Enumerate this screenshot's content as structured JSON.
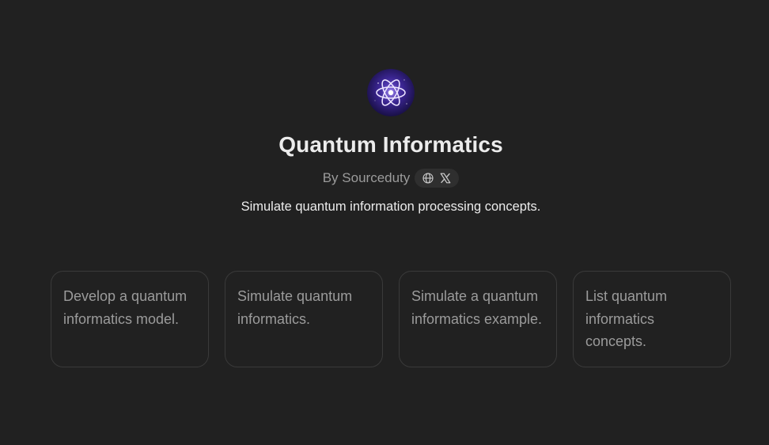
{
  "gpt": {
    "avatar_icon": "atom-icon",
    "name": "Quantum Informatics",
    "byline": "By Sourceduty",
    "links": [
      {
        "icon": "globe-icon"
      },
      {
        "icon": "x-logo-icon"
      }
    ],
    "description": "Simulate quantum information processing concepts."
  },
  "conversation_starters": [
    {
      "text": "Develop a quantum informatics model."
    },
    {
      "text": "Simulate quantum informatics."
    },
    {
      "text": "Simulate a quantum informatics example."
    },
    {
      "text": "List quantum informatics concepts."
    }
  ],
  "colors": {
    "background": "#212121",
    "title_text": "#ececec",
    "muted_text": "#9b9b9b",
    "card_border": "#3a3a3a",
    "pill_background": "#2f2f2f",
    "avatar_accent": "#5b3fb0"
  }
}
